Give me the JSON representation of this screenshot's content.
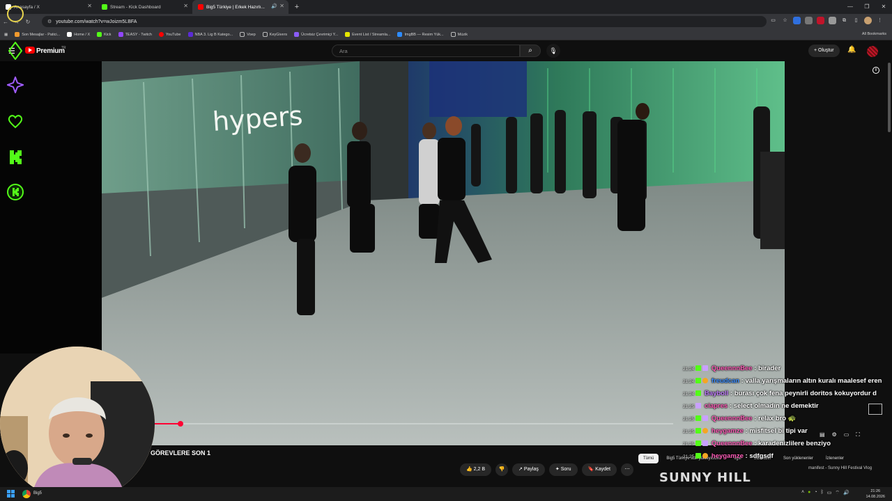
{
  "browser": {
    "tabs": [
      {
        "label": "Anasayfa / X",
        "color": "#ffffff"
      },
      {
        "label": "Stream - Kick Dashboard",
        "color": "#53fc18"
      },
      {
        "label": "Big5 Türkiye | Erkek Hazırlı...",
        "color": "#ff0000"
      }
    ],
    "url": "youtube.com/watch?v=wJoizm5LBFA",
    "bookmarks": [
      "Son Mesajlar - Patici...",
      "Home / X",
      "Kick",
      "TEASY - Twitch",
      "YouTube",
      "NBA 3. Lig B Katego...",
      "Voep",
      "KeyGivers",
      "Ücretsiz Çevrimiçi Y...",
      "Event List / Streamla...",
      "ImgBB — Resim Yük...",
      "Müzik"
    ],
    "all_bookmarks": "All Bookmarks"
  },
  "youtube": {
    "brand": "Premium",
    "region": "TR",
    "search_placeholder": "Ara",
    "create_label": "Oluştur"
  },
  "video": {
    "scene_sign": "hypers",
    "progress": 0.05,
    "title": "GÖREVLERE SON 1",
    "actions": {
      "likes": "2,2 B",
      "share": "Paylaş",
      "ask": "Soru",
      "save": "Kaydet"
    },
    "chips": [
      "Tümü",
      "Big5 Türkiye adlı yükleyiciden",
      "İlgili",
      "Size özel",
      "Son yüklenenler",
      "İzlenenler"
    ]
  },
  "chat": [
    {
      "time": "21:24",
      "user": "QueennnBee",
      "user_color": "#ff5cb8",
      "text": "birader"
    },
    {
      "time": "21:24",
      "user": "freudcan",
      "user_color": "#3b8cff",
      "text": "valla yarışmaların altın kuralı maalesef eren"
    },
    {
      "time": "21:24",
      "user": "Bayboll",
      "user_color": "#c27bff",
      "text": "burası çok fena peynirli doritos kokuyordur d"
    },
    {
      "time": "21:25",
      "user": "ciapres",
      "user_color": "#ff5cb8",
      "text": "select olmadın ne demektir"
    },
    {
      "time": "21:25",
      "user": "QueennnBee",
      "user_color": "#ff5cb8",
      "text": "relax bro 🐢"
    },
    {
      "time": "21:25",
      "user": "heygamze",
      "user_color": "#ff5cb8",
      "text": "misfitsel bi tipi var"
    },
    {
      "time": "21:25",
      "user": "QueennnBee",
      "user_color": "#ff5cb8",
      "text": "karadenizlilere benziyo"
    },
    {
      "time": "21:25",
      "user": "heygamze",
      "user_color": "#ff5cb8",
      "text": "sdfgsdf"
    }
  ],
  "overlay": {
    "watermark": "SUNNY HILL",
    "vlog_line1": "manifest - Sunny Hill Festival Vlog",
    "vlog_line2": ""
  },
  "taskbar": {
    "app_label": "Big5",
    "time": "21:26",
    "date": "14.08.2026"
  },
  "colors": {
    "kick_green": "#53fc18",
    "yt_red": "#ff0000",
    "progress_red": "#ff0033"
  }
}
